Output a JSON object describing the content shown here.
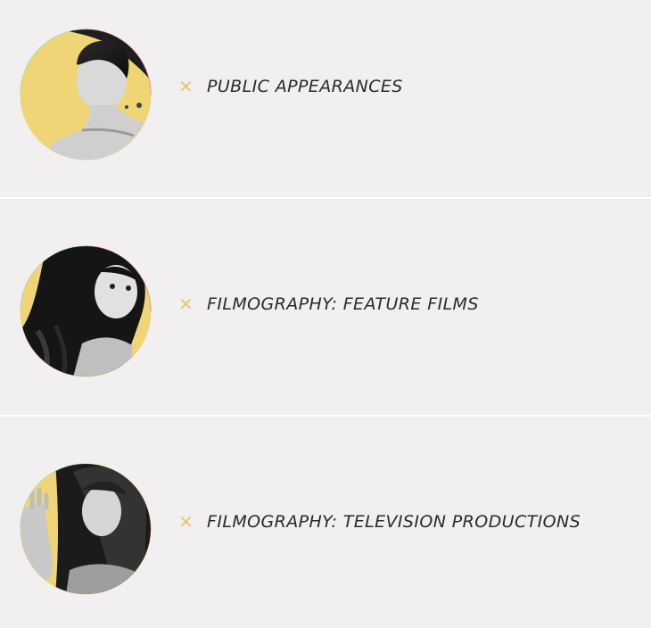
{
  "colors": {
    "background": "#f1eff0",
    "divider": "#ffffff",
    "accent_yellow": "#efd576",
    "accent_cyan": "#7fd6dc",
    "accent_pink": "#d9547c",
    "marker": "#e8c96a",
    "text": "#2a2a2a"
  },
  "marker_glyph": "✕",
  "items": [
    {
      "label": "PUBLIC APPEARANCES",
      "icon": "x-icon"
    },
    {
      "label": "FILMOGRAPHY: FEATURE FILMS",
      "icon": "x-icon"
    },
    {
      "label": "FILMOGRAPHY: TELEVISION PRODUCTIONS",
      "icon": "x-icon"
    }
  ]
}
